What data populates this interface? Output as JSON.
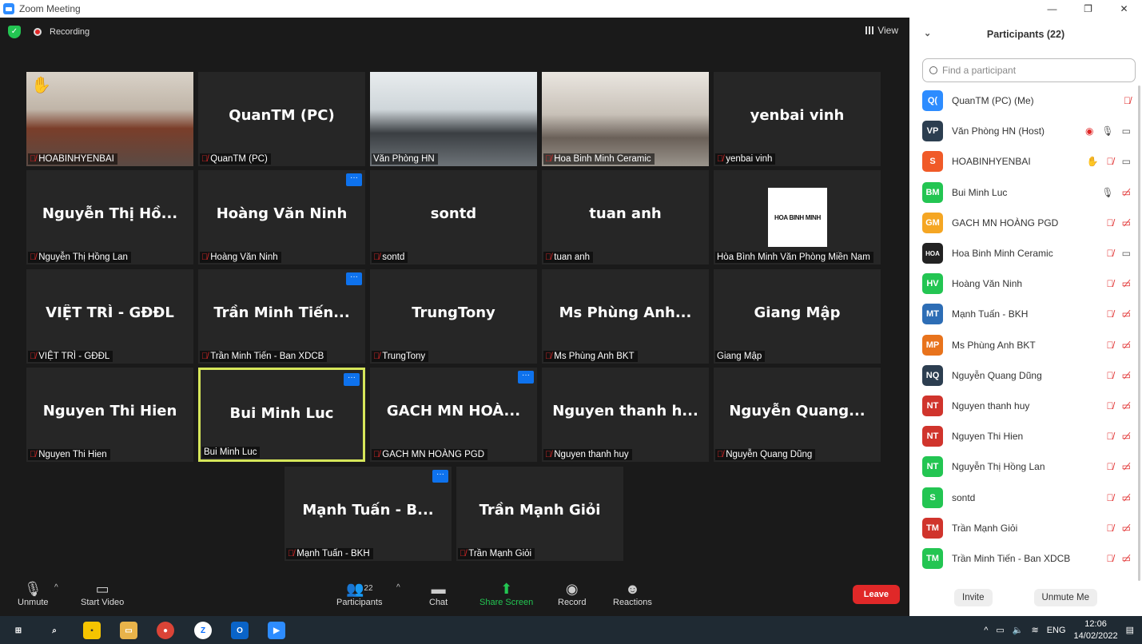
{
  "window": {
    "title": "Zoom Meeting",
    "minimize": "—",
    "restore": "❐",
    "close": "✕"
  },
  "topbar": {
    "recording": "Recording",
    "view": "View"
  },
  "tiles": [
    {
      "label": "HOABINHYENBAI",
      "big": ""
    },
    {
      "label": "QuanTM (PC)",
      "big": "QuanTM (PC)"
    },
    {
      "label": "Văn Phòng HN",
      "big": ""
    },
    {
      "label": "Hoa Binh Minh Ceramic",
      "big": ""
    },
    {
      "label": "yenbai vinh",
      "big": "yenbai vinh"
    },
    {
      "label": "Nguyễn Thị Hồng Lan",
      "big": "Nguyễn Thị Hồ..."
    },
    {
      "label": "Hoàng Văn Ninh",
      "big": "Hoàng Văn Ninh"
    },
    {
      "label": "sontd",
      "big": "sontd"
    },
    {
      "label": "tuan anh",
      "big": "tuan anh"
    },
    {
      "label": "Hòa Bình Minh Văn Phòng Miền Nam",
      "big": "",
      "logo": "HOA BINH MINH"
    },
    {
      "label": "VIỆT TRÌ - GĐĐL",
      "big": "VIỆT TRÌ - GĐĐL"
    },
    {
      "label": "Trần Minh Tiến - Ban XDCB",
      "big": "Trần Minh Tiến..."
    },
    {
      "label": "TrungTony",
      "big": "TrungTony"
    },
    {
      "label": "Ms Phùng Anh BKT",
      "big": "Ms Phùng Anh..."
    },
    {
      "label": "Giang Mập",
      "big": "Giang Mập"
    },
    {
      "label": "Nguyen Thi Hien",
      "big": "Nguyen Thi Hien"
    },
    {
      "label": "Bui Minh Luc",
      "big": "Bui Minh Luc"
    },
    {
      "label": "GACH MN HOÀNG PGD",
      "big": "GACH MN HOÀ..."
    },
    {
      "label": "Nguyen thanh huy",
      "big": "Nguyen thanh h..."
    },
    {
      "label": "Nguyễn Quang Dũng",
      "big": "Nguyễn Quang..."
    },
    {
      "label": "Mạnh Tuấn -  BKH",
      "big": "Mạnh Tuấn -  B..."
    },
    {
      "label": "Trần Mạnh Giỏi",
      "big": "Trần Mạnh Giỏi"
    }
  ],
  "toolbar": {
    "unmute": "Unmute",
    "start_video": "Start Video",
    "participants": "Participants",
    "participants_count": "22",
    "chat": "Chat",
    "share_screen": "Share Screen",
    "record": "Record",
    "reactions": "Reactions",
    "leave": "Leave"
  },
  "panel": {
    "title": "Participants (22)",
    "search_placeholder": "Find a participant",
    "invite": "Invite",
    "unmute_me": "Unmute Me",
    "participants": [
      {
        "initials": "Q(",
        "name": "QuanTM (PC) (Me)",
        "color": "#2d8cff"
      },
      {
        "initials": "VP",
        "name": "Văn Phòng HN (Host)",
        "color": "#2c3e50"
      },
      {
        "initials": "S",
        "name": "HOABINHYENBAI",
        "color": "#f05a28"
      },
      {
        "initials": "BM",
        "name": "Bui Minh Luc",
        "color": "#23c552"
      },
      {
        "initials": "GM",
        "name": "GACH MN HOÀNG PGD",
        "color": "#f5a623"
      },
      {
        "initials": "HOA",
        "name": "Hoa Binh Minh Ceramic",
        "color": "#222222"
      },
      {
        "initials": "HV",
        "name": "Hoàng Văn Ninh",
        "color": "#23c552"
      },
      {
        "initials": "MT",
        "name": "Mạnh Tuấn -  BKH",
        "color": "#2d6db5"
      },
      {
        "initials": "MP",
        "name": "Ms Phùng Anh BKT",
        "color": "#e8731c"
      },
      {
        "initials": "NQ",
        "name": "Nguyễn Quang Dũng",
        "color": "#2c3e50"
      },
      {
        "initials": "NT",
        "name": "Nguyen thanh huy",
        "color": "#d0342c"
      },
      {
        "initials": "NT",
        "name": "Nguyen Thi Hien",
        "color": "#d0342c"
      },
      {
        "initials": "NT",
        "name": "Nguyễn Thị Hồng Lan",
        "color": "#23c552"
      },
      {
        "initials": "S",
        "name": "sontd",
        "color": "#23c552"
      },
      {
        "initials": "TM",
        "name": "Trần Mạnh Giỏi",
        "color": "#d0342c"
      },
      {
        "initials": "TM",
        "name": "Trần Minh Tiến - Ban XDCB",
        "color": "#23c552"
      }
    ]
  },
  "taskbar": {
    "lang": "ENG",
    "time": "12:06",
    "date": "14/02/2022"
  }
}
